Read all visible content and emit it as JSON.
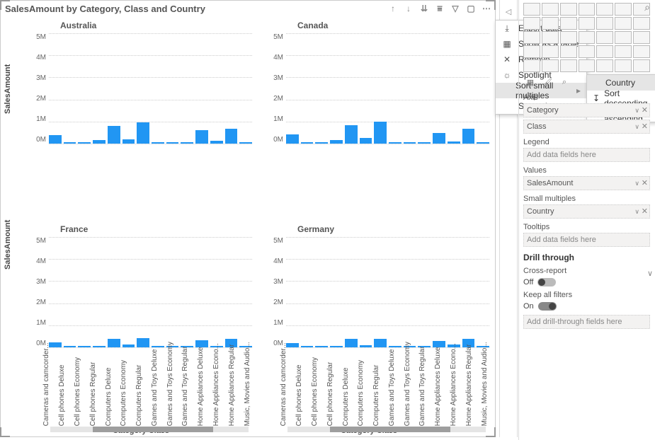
{
  "visual": {
    "title": "SalesAmount by Category, Class and Country",
    "header_icons": [
      "drill-up",
      "drill-down",
      "expand",
      "hierarchy",
      "filter",
      "focus",
      "more"
    ],
    "y_axis_label": "SalesAmount",
    "x_axis_label": "Category Class",
    "y_ticks": [
      "5M",
      "4M",
      "3M",
      "2M",
      "1M",
      "0M"
    ],
    "categories": [
      "Cameras and camcorder...",
      "Cell phones Deluxe",
      "Cell phones Economy",
      "Cell phones Regular",
      "Computers Deluxe",
      "Computers Economy",
      "Computers Regular",
      "Games and Toys Deluxe",
      "Games and Toys Economy",
      "Games and Toys Regular",
      "Home Appliances Deluxe",
      "Home Appliances Econo...",
      "Home Appliances Regular",
      "Music, Movies and Audio..."
    ],
    "panels": [
      {
        "name": "Australia"
      },
      {
        "name": "Canada"
      },
      {
        "name": "France"
      },
      {
        "name": "Germany"
      }
    ]
  },
  "chart_data": {
    "type": "bar",
    "ylabel": "SalesAmount",
    "xlabel": "Category Class",
    "ylim": [
      0,
      5000000
    ],
    "title": "SalesAmount by Category, Class and Country",
    "categories": [
      "Cameras and camcorders",
      "Cell phones Deluxe",
      "Cell phones Economy",
      "Cell phones Regular",
      "Computers Deluxe",
      "Computers Economy",
      "Computers Regular",
      "Games and Toys Deluxe",
      "Games and Toys Economy",
      "Games and Toys Regular",
      "Home Appliances Deluxe",
      "Home Appliances Economy",
      "Home Appliances Regular",
      "Music, Movies and Audio"
    ],
    "series": [
      {
        "name": "Australia",
        "values": [
          400000,
          80000,
          80000,
          150000,
          800000,
          180000,
          950000,
          30000,
          30000,
          50000,
          620000,
          120000,
          680000,
          60000
        ]
      },
      {
        "name": "Canada",
        "values": [
          420000,
          80000,
          70000,
          150000,
          820000,
          250000,
          1000000,
          30000,
          30000,
          60000,
          480000,
          100000,
          680000,
          50000
        ]
      },
      {
        "name": "France",
        "values": [
          230000,
          40000,
          40000,
          80000,
          390000,
          140000,
          430000,
          20000,
          20000,
          30000,
          310000,
          60000,
          370000,
          30000
        ]
      },
      {
        "name": "Germany",
        "values": [
          200000,
          40000,
          40000,
          70000,
          370000,
          100000,
          400000,
          20000,
          20000,
          30000,
          300000,
          120000,
          370000,
          30000
        ]
      }
    ]
  },
  "context_menu": {
    "items": [
      {
        "icon": "export",
        "label": "Export data"
      },
      {
        "icon": "table",
        "label": "Show as a table"
      },
      {
        "icon": "remove",
        "label": "Remove"
      },
      {
        "icon": "spotlight",
        "label": "Spotlight"
      },
      {
        "icon": "",
        "label": "Sort small multiples",
        "has_sub": true,
        "highlight": true
      },
      {
        "icon": "",
        "label": "Sort axis",
        "has_sub": true
      }
    ],
    "submenu": [
      {
        "label": "Country",
        "highlight": true,
        "icon": ""
      },
      {
        "label": "Sort descending",
        "icon": "desc"
      },
      {
        "label": "Sort ascending",
        "icon": "asc"
      }
    ]
  },
  "format_pane": {
    "axis_heading": "Axis",
    "axis_wells": [
      "Category",
      "Class"
    ],
    "legend_heading": "Legend",
    "legend_placeholder": "Add data fields here",
    "values_heading": "Values",
    "values_wells": [
      "SalesAmount"
    ],
    "small_heading": "Small multiples",
    "small_wells": [
      "Country"
    ],
    "tooltips_heading": "Tooltips",
    "tooltips_placeholder": "Add data fields here",
    "drillthrough": "Drill through",
    "cross_report_label": "Cross-report",
    "cross_report_value": "Off",
    "keep_filters_label": "Keep all filters",
    "keep_filters_value": "On",
    "drill_placeholder": "Add drill-through fields here"
  }
}
